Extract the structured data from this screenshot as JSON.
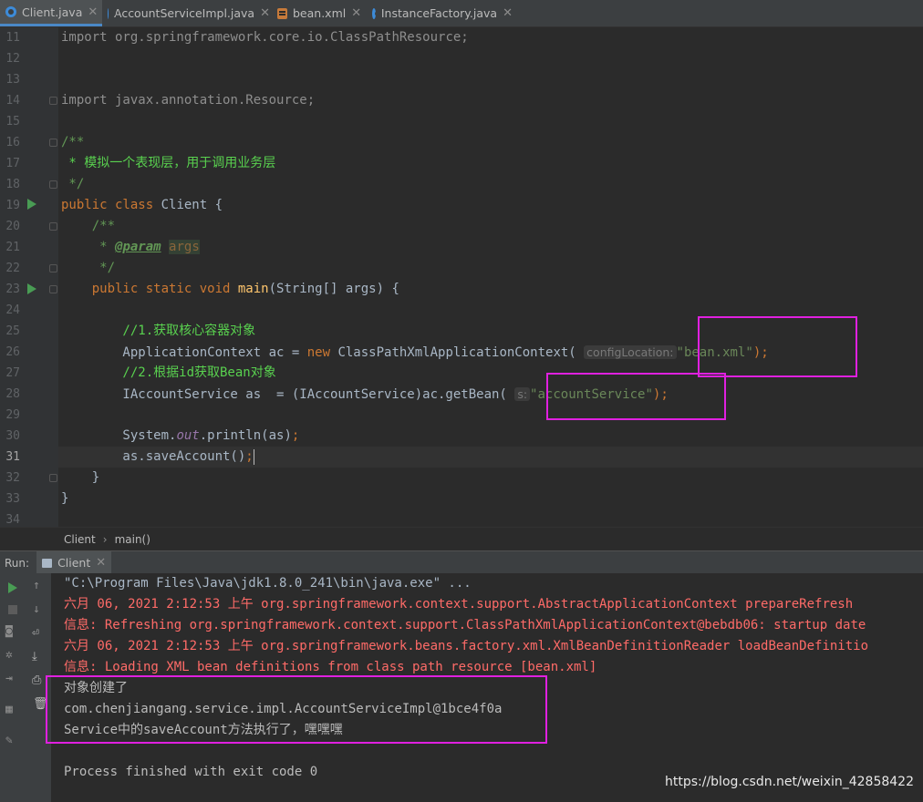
{
  "tabs": [
    {
      "label": "Client.java",
      "icon": "java-class-icon",
      "active": true
    },
    {
      "label": "AccountServiceImpl.java",
      "icon": "java-class-icon",
      "active": false
    },
    {
      "label": "bean.xml",
      "icon": "xml-file-icon",
      "active": false
    },
    {
      "label": "InstanceFactory.java",
      "icon": "java-class-icon",
      "active": false
    }
  ],
  "editor": {
    "line_numbers": [
      "11",
      "12",
      "13",
      "14",
      "15",
      "16",
      "17",
      "18",
      "19",
      "20",
      "21",
      "22",
      "23",
      "24",
      "25",
      "26",
      "27",
      "28",
      "29",
      "30",
      "31",
      "32",
      "33",
      "34"
    ],
    "current_line": "31",
    "code": {
      "l11_import": "import",
      "l11_pkg": " org.springframework.core.io.ClassPathResource;",
      "l14_import": "import",
      "l14_pkg": " javax.annotation.Resource;",
      "l16": "/**",
      "l17": " * 模拟一个表现层，用于调用业务层",
      "l18": " */",
      "l19_kw": "public class",
      "l19_rest": " Client {",
      "l20": "    /**",
      "l21_star": "     * ",
      "l21_tag": "@param",
      "l21_arg": "args",
      "l22": "     */",
      "l23_kw": "    public static void",
      "l23_fn": "main",
      "l23_rest": "(String[] args) {",
      "l25": "        //1.获取核心容器对象",
      "l26_a": "        ApplicationContext ac = ",
      "l26_new": "new",
      "l26_b": " ClassPathXmlApplicationContext(",
      "l26_hint": "configLocation:",
      "l26_str": "\"bean.xml\"",
      "l26_end": ");",
      "l27": "        //2.根据id获取Bean对象",
      "l28_a": "        IAccountService as  = (IAccountService)ac.getBean(",
      "l28_hint": "s:",
      "l28_str": "\"accountService\"",
      "l28_end": ");",
      "l30_a": "        System.",
      "l30_out": "out",
      "l30_b": ".println(as)",
      "l30_end": ";",
      "l31_a": "        as.saveAccount()",
      "l31_end": ";",
      "l32": "    }",
      "l33": "}"
    }
  },
  "breadcrumb": {
    "class": "Client",
    "method": "main()"
  },
  "run": {
    "label": "Run:",
    "tab": "Client",
    "console": {
      "cmd": "\"C:\\Program Files\\Java\\jdk1.8.0_241\\bin\\java.exe\" ...",
      "log1": "六月 06, 2021 2:12:53 上午 org.springframework.context.support.AbstractApplicationContext prepareRefresh",
      "log2": "信息: Refreshing org.springframework.context.support.ClassPathXmlApplicationContext@bebdb06: startup date",
      "log3": "六月 06, 2021 2:12:53 上午 org.springframework.beans.factory.xml.XmlBeanDefinitionReader loadBeanDefinitio",
      "log4": "信息: Loading XML bean definitions from class path resource [bean.xml]",
      "out1": "对象创建了",
      "out2": "com.chenjiangang.service.impl.AccountServiceImpl@1bce4f0a",
      "out3": "Service中的saveAccount方法执行了，嘿嘿嘿",
      "exit": "Process finished with exit code 0"
    }
  },
  "watermark": "https://blog.csdn.net/weixin_42858422",
  "colors": {
    "keyword": "#cc7832",
    "string": "#6a8759",
    "comment_cn": "#59d14f",
    "error": "#ff6b68",
    "highlight_box": "#e020e0"
  }
}
